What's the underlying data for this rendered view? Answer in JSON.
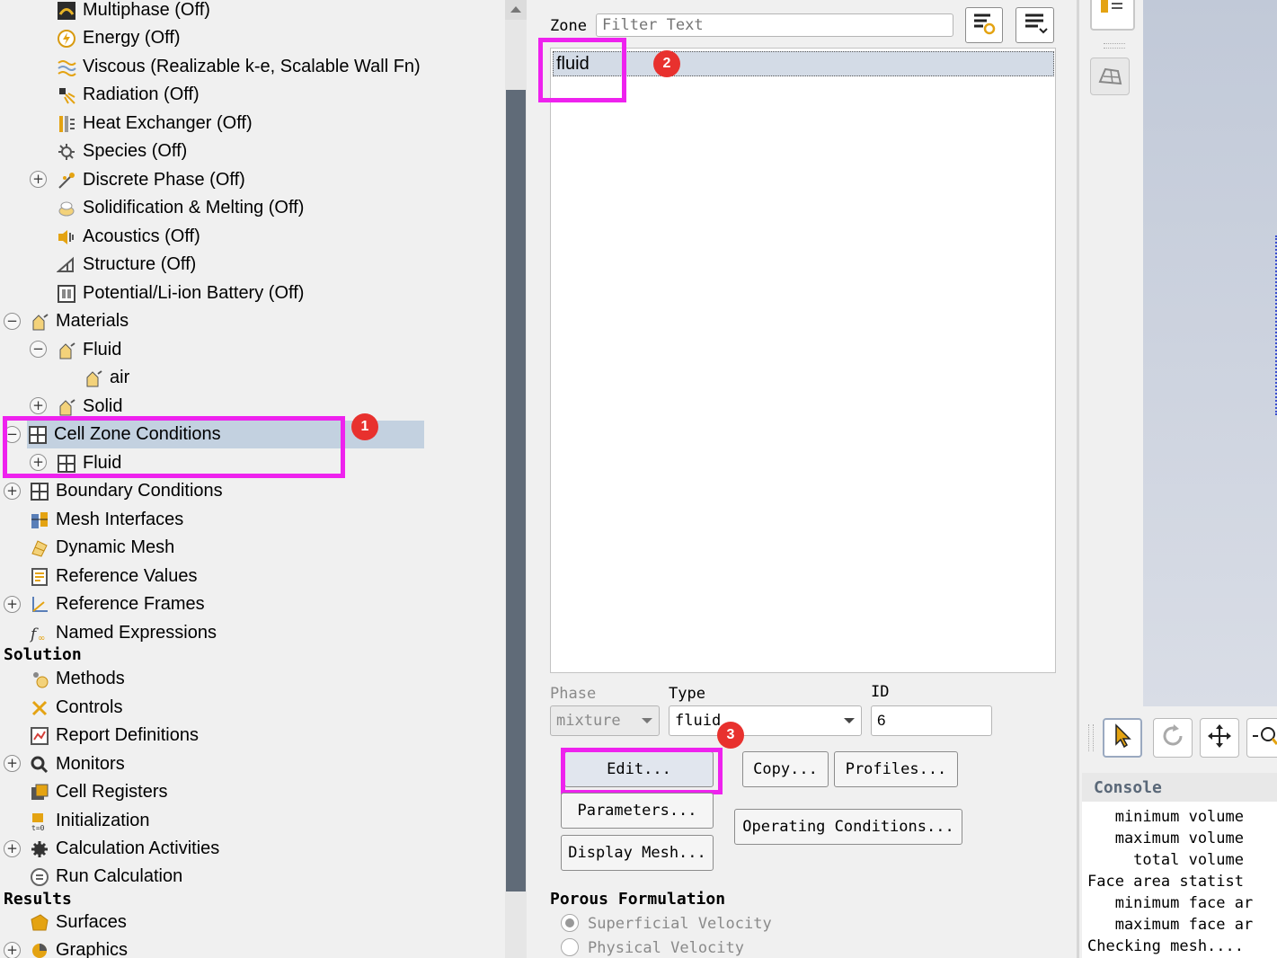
{
  "tree": {
    "items": [
      {
        "label": "Multiphase (Off)"
      },
      {
        "label": "Energy (Off)"
      },
      {
        "label": "Viscous (Realizable k-e, Scalable Wall Fn)"
      },
      {
        "label": "Radiation (Off)"
      },
      {
        "label": "Heat Exchanger (Off)"
      },
      {
        "label": "Species (Off)"
      },
      {
        "label": "Discrete Phase (Off)"
      },
      {
        "label": "Solidification & Melting (Off)"
      },
      {
        "label": "Acoustics (Off)"
      },
      {
        "label": "Structure (Off)"
      },
      {
        "label": "Potential/Li-ion Battery (Off)"
      },
      {
        "label": "Materials"
      },
      {
        "label": "Fluid"
      },
      {
        "label": "air"
      },
      {
        "label": "Solid"
      },
      {
        "label": "Cell Zone Conditions"
      },
      {
        "label": "Fluid"
      },
      {
        "label": "Boundary Conditions"
      },
      {
        "label": "Mesh Interfaces"
      },
      {
        "label": "Dynamic Mesh"
      },
      {
        "label": "Reference Values"
      },
      {
        "label": "Reference Frames"
      },
      {
        "label": "Named Expressions"
      },
      {
        "label": "Methods"
      },
      {
        "label": "Controls"
      },
      {
        "label": "Report Definitions"
      },
      {
        "label": "Monitors"
      },
      {
        "label": "Cell Registers"
      },
      {
        "label": "Initialization"
      },
      {
        "label": "Calculation Activities"
      },
      {
        "label": "Run Calculation"
      },
      {
        "label": "Surfaces"
      },
      {
        "label": "Graphics"
      }
    ],
    "sections": {
      "solution": "Solution",
      "results": "Results"
    }
  },
  "task": {
    "zone_label": "Zone",
    "filter_placeholder": "Filter Text",
    "zones": [
      "fluid"
    ],
    "phase_label": "Phase",
    "phase_value": "mixture",
    "type_label": "Type",
    "type_value": "fluid",
    "id_label": "ID",
    "id_value": "6",
    "buttons": {
      "edit": "Edit...",
      "copy": "Copy...",
      "profiles": "Profiles...",
      "parameters": "Parameters...",
      "operating": "Operating Conditions...",
      "display_mesh": "Display Mesh..."
    },
    "porous_title": "Porous Formulation",
    "porous_options": [
      "Superficial Velocity",
      "Physical Velocity"
    ]
  },
  "annotations": [
    "1",
    "2",
    "3"
  ],
  "console": {
    "title": "Console",
    "lines": [
      "   minimum volume",
      "   maximum volume",
      "     total volume",
      "Face area statist",
      "   minimum face ar",
      "   maximum face ar",
      "Checking mesh...."
    ]
  },
  "colors": {
    "highlight": "#ee22ee",
    "badge": "#e8312e",
    "selected": "#c3d1e0"
  }
}
